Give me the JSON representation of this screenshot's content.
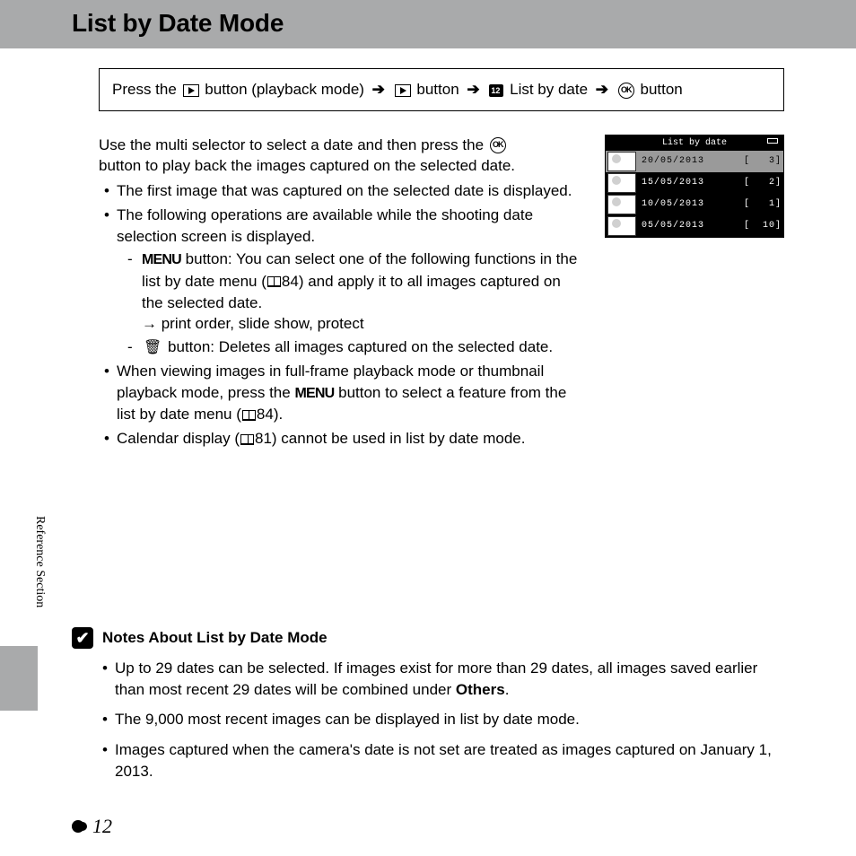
{
  "header": {
    "title": "List by Date Mode"
  },
  "breadcrumb": {
    "press": "Press the ",
    "playback": " button (playback mode) ",
    "btn2": " button ",
    "listby": " List by date ",
    "okbtn": " button"
  },
  "intro": "Use the multi selector to select a date and then press the ",
  "intro2": " button to play back the images captured on the selected date.",
  "bullets": {
    "b1": "The first image that was captured on the selected date is displayed.",
    "b2": "The following operations are available while the shooting date selection screen is displayed.",
    "s1a": " button: You can select one of the following functions in the list by date menu (",
    "s1b": "84) and apply it to all images captured on the selected date.",
    "s1c": "→ print order, slide show, protect",
    "s2": " button: Deletes all images captured on the selected date.",
    "b3a": "When viewing images in full-frame playback mode or thumbnail playback mode, press the ",
    "b3b": " button to select a feature from the list by date menu (",
    "b3c": "84).",
    "b4a": "Calendar display (",
    "b4b": "81) cannot be used in list by date mode."
  },
  "screen": {
    "title": "List by date",
    "rows": [
      {
        "date": "20/05/2013",
        "count": "3"
      },
      {
        "date": "15/05/2013",
        "count": "2"
      },
      {
        "date": "10/05/2013",
        "count": "1"
      },
      {
        "date": "05/05/2013",
        "count": "10"
      }
    ]
  },
  "sidebar": "Reference Section",
  "notes": {
    "heading": "Notes About List by Date Mode",
    "n1a": "Up to 29 dates can be selected. If images exist for more than 29 dates, all images saved earlier than most recent 29 dates will be combined under ",
    "n1b": "Others",
    "n1c": ".",
    "n2": "The 9,000 most recent images can be displayed in list by date mode.",
    "n3": "Images captured when the camera's date is not set are treated as images captured on January 1, 2013."
  },
  "page": "12",
  "menu_glyph": "MENU"
}
